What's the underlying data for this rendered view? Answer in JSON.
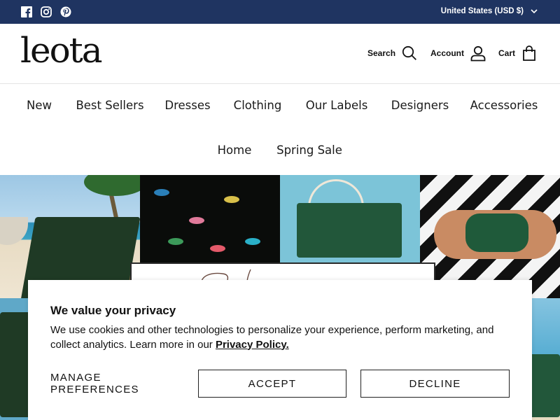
{
  "topbar": {
    "background": "#1f3461",
    "social": [
      {
        "icon": "facebook-icon"
      },
      {
        "icon": "instagram-icon"
      },
      {
        "icon": "pinterest-icon"
      }
    ],
    "currency_label": "United States (USD $)"
  },
  "header": {
    "logo": "leota",
    "search_label": "Search",
    "account_label": "Account",
    "cart_label": "Cart"
  },
  "nav": {
    "items": [
      "New",
      "Best Sellers",
      "Dresses",
      "Clothing",
      "Our Labels",
      "Designers",
      "Accessories",
      "Home",
      "Spring Sale"
    ]
  },
  "cookie": {
    "title": "We value your privacy",
    "text": "We use cookies and other technologies to personalize your experience, perform marketing, and collect analytics. Learn more in our ",
    "link": "Privacy Policy.",
    "manage_label": "MANAGE PREFERENCES",
    "accept_label": "ACCEPT",
    "decline_label": "DECLINE"
  }
}
